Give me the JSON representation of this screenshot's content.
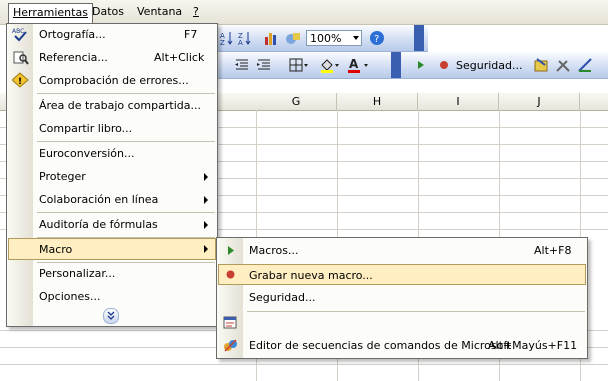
{
  "menubar": {
    "items": [
      {
        "label": "Herramientas"
      },
      {
        "label": "Datos"
      },
      {
        "label": "Ventana"
      },
      {
        "label": "?"
      }
    ]
  },
  "toolbar": {
    "zoom": "100%",
    "seguridad_label": "Seguridad..."
  },
  "sheet": {
    "columns": [
      "G",
      "H",
      "I",
      "J"
    ]
  },
  "tools_menu": {
    "items": [
      {
        "label": "Ortografía...",
        "shortcut": "F7"
      },
      {
        "label": "Referencia...",
        "shortcut": "Alt+Click"
      },
      {
        "label": "Comprobación de errores..."
      },
      {
        "label": "Área de trabajo compartida..."
      },
      {
        "label": "Compartir libro..."
      },
      {
        "label": "Euroconversión..."
      },
      {
        "label": "Proteger"
      },
      {
        "label": "Colaboración en línea"
      },
      {
        "label": "Auditoría de fórmulas"
      },
      {
        "label": "Macro"
      },
      {
        "label": "Personalizar..."
      },
      {
        "label": "Opciones..."
      }
    ],
    "expand_icon": "double-chevron-down-icon"
  },
  "macro_submenu": {
    "items": [
      {
        "label": "Macros...",
        "shortcut": "Alt+F8"
      },
      {
        "label": "Grabar nueva macro..."
      },
      {
        "label": "Seguridad..."
      },
      {
        "label": ""
      },
      {
        "label": "Editor de secuencias de comandos de Microsoft",
        "shortcut": "Alt+Mayús+F11"
      }
    ]
  },
  "colors": {
    "highlight": "#ffeec2",
    "highlight_border": "#b29a5a",
    "toolbar_blue": "#cfdcf2"
  }
}
